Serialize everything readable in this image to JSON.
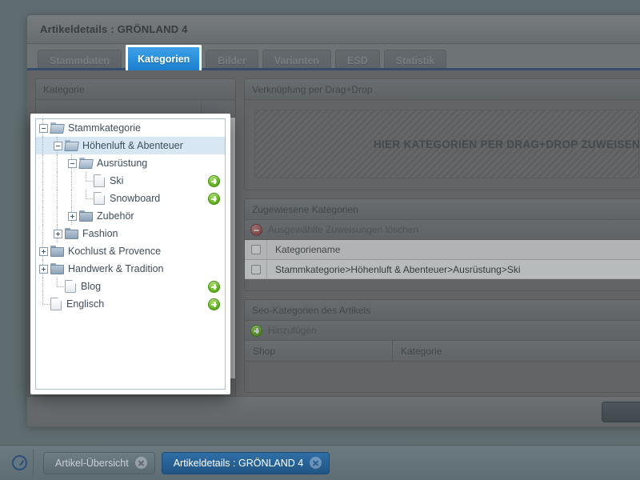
{
  "window": {
    "title": "Artikeldetails : GRÖNLAND 4",
    "tabs": [
      {
        "label": "Stammdaten",
        "active": false
      },
      {
        "label": "Kategorien",
        "active": true
      },
      {
        "label": "Bilder",
        "active": false
      },
      {
        "label": "Varianten",
        "active": false
      },
      {
        "label": "ESD",
        "active": false
      },
      {
        "label": "Statistik",
        "active": false
      }
    ]
  },
  "left_panel": {
    "header": "Kategorie"
  },
  "dragdrop_panel": {
    "header": "Verknüpfung per Drag+Drop",
    "dropzone_text": "HIER KATEGORIEN PER DRAG+DROP ZUWEISEN"
  },
  "assigned_panel": {
    "header": "Zugewiesene Kategorien",
    "toolbar_delete_label": "Ausgewählte Zuweisungen löschen",
    "toolbar_delete_icon": "minus-circle-icon",
    "columns": [
      "Kategoriename"
    ],
    "rows": [
      {
        "checked": false,
        "name": "Stammkategorie>Höhenluft & Abenteuer>Ausrüstung>Ski"
      }
    ]
  },
  "seo_panel": {
    "header": "Seo-Kategorien des Artikels",
    "add_label": "Hinzufügen",
    "add_icon": "plus-circle-icon",
    "columns": [
      "Shop",
      "Kategorie"
    ],
    "rows": []
  },
  "tree_popup": {
    "nodes": [
      {
        "label": "Stammkategorie",
        "depth": 0,
        "icon": "folder-open-icon",
        "toggle": "minus",
        "selected": false,
        "add": false
      },
      {
        "label": "Höhenluft & Abenteuer",
        "depth": 1,
        "icon": "folder-open-icon",
        "toggle": "minus",
        "selected": true,
        "add": false
      },
      {
        "label": "Ausrüstung",
        "depth": 2,
        "icon": "folder-open-icon",
        "toggle": "minus",
        "selected": false,
        "add": false
      },
      {
        "label": "Ski",
        "depth": 3,
        "icon": "document-icon",
        "toggle": "leaf",
        "selected": false,
        "add": true
      },
      {
        "label": "Snowboard",
        "depth": 3,
        "icon": "document-icon",
        "toggle": "leaf",
        "selected": false,
        "add": true
      },
      {
        "label": "Zubehör",
        "depth": 2,
        "icon": "folder-icon",
        "toggle": "plus",
        "selected": false,
        "add": false
      },
      {
        "label": "Fashion",
        "depth": 1,
        "icon": "folder-icon",
        "toggle": "plus",
        "selected": false,
        "add": false
      },
      {
        "label": "Kochlust & Provence",
        "depth": 0,
        "icon": "folder-icon",
        "toggle": "plus",
        "selected": false,
        "add": false
      },
      {
        "label": "Handwerk & Tradition",
        "depth": 0,
        "icon": "folder-icon",
        "toggle": "plus",
        "selected": false,
        "add": false
      },
      {
        "label": "Blog",
        "depth": 1,
        "icon": "document-icon",
        "toggle": "leaf",
        "selected": false,
        "add": true
      },
      {
        "label": "Englisch",
        "depth": 0,
        "icon": "document-icon",
        "toggle": "leaf",
        "selected": false,
        "add": true
      }
    ]
  },
  "taskbar": {
    "start_icon": "gauge-icon",
    "items": [
      {
        "label": "Artikel-Übersicht",
        "active": false,
        "close_icon": "close-icon"
      },
      {
        "label": "Artikeldetails : GRÖNLAND 4",
        "active": true,
        "close_icon": "close-icon"
      }
    ]
  },
  "colors": {
    "accent_blue": "#1c7fd0",
    "tab_underline": "#3d5a87",
    "selection": "#d7e7f4",
    "add_green": "#63b521",
    "delete_red": "#a85a5a",
    "desktop": "#78878b"
  }
}
